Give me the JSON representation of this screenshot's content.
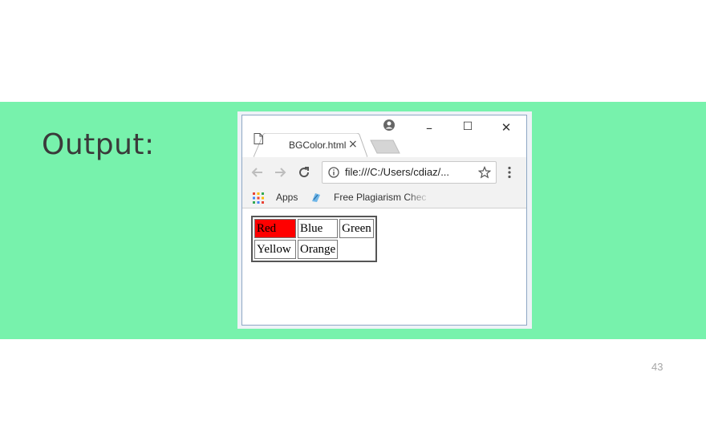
{
  "slide": {
    "heading": "Output:",
    "page_number": "43",
    "band_color": "#77f2ac"
  },
  "browser": {
    "tab_title": "BGColor.html",
    "tab_close": "×",
    "window_controls": {
      "minimize": "–",
      "maximize": "☐",
      "close": "✕"
    },
    "icons": [
      "file-icon",
      "profile-icon",
      "back-arrow-icon",
      "forward-arrow-icon",
      "reload-icon",
      "info-icon",
      "star-icon",
      "menu-dots-icon",
      "apps-grid-icon",
      "bookmark-icon"
    ],
    "address": "file:///C:/Users/cdiaz/...",
    "bookmarks": {
      "apps_label": "Apps",
      "item_label": "Free Plagiarism Chec"
    }
  },
  "page_table": {
    "rows": [
      [
        {
          "text": "Red",
          "bg": "#ff0000"
        },
        {
          "text": "Blue",
          "bg": "#ffffff"
        },
        {
          "text": "Green",
          "bg": "#ffffff"
        }
      ],
      [
        {
          "text": "Yellow",
          "bg": "#ffffff"
        },
        {
          "text": "Orange",
          "bg": "#ffffff"
        }
      ]
    ]
  }
}
